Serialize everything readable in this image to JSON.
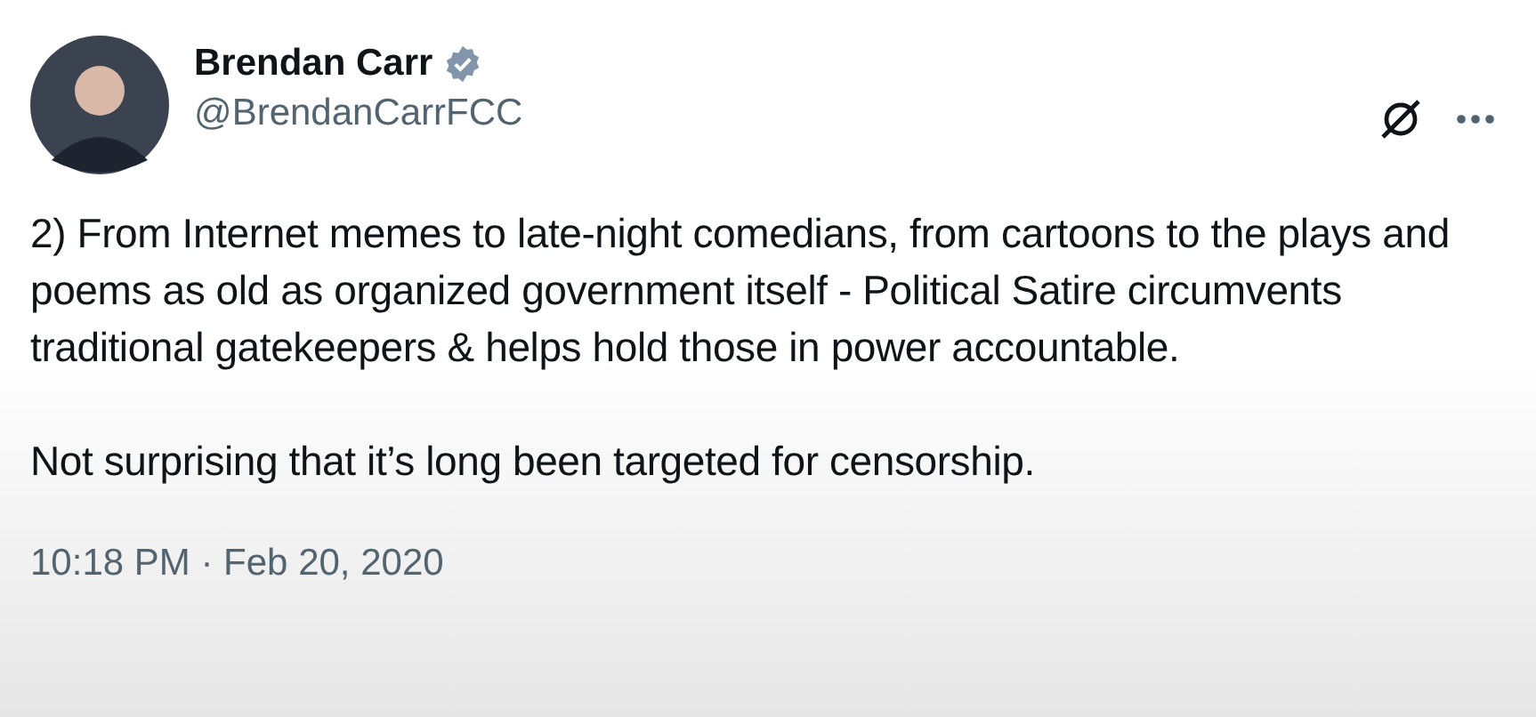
{
  "author": {
    "name": "Brendan Carr",
    "verified": true,
    "handle": "@BrendanCarrFCC"
  },
  "paragraphs": [
    "2) From Internet memes to late-night comedians, from cartoons to the plays and poems as old as organized government itself - Political Satire circumvents traditional gatekeepers & helps hold those in power accountable.",
    "Not surprising that it’s long been targeted for censorship."
  ],
  "timestamp": "10:18 PM · Feb 20, 2020"
}
